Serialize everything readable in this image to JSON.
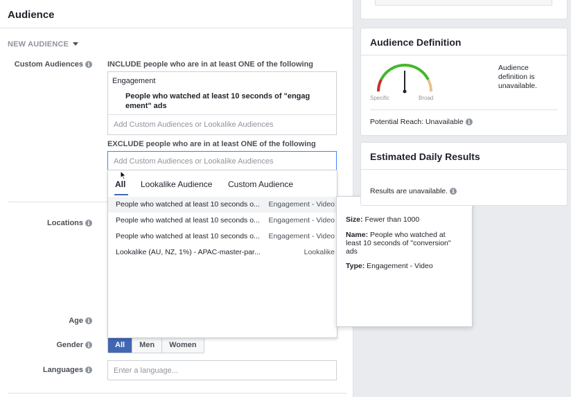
{
  "audience_panel": {
    "title": "Audience",
    "new_audience_label": "NEW AUDIENCE",
    "custom_audiences_label": "Custom Audiences",
    "include_heading": "INCLUDE people who are in at least ONE of the following",
    "include_category": "Engagement",
    "include_item_line1": "People who watched at least 10 seconds of \"engag",
    "include_item_line2": "ement\" ads",
    "include_add_placeholder": "Add Custom Audiences or Lookalike Audiences",
    "exclude_heading": "EXCLUDE people who are in at least ONE of the following",
    "exclude_placeholder": "Add Custom Audiences or Lookalike Audiences",
    "locations_label": "Locations",
    "age_label": "Age",
    "gender_label": "Gender",
    "gender_options": [
      "All",
      "Men",
      "Women"
    ],
    "gender_selected": "All",
    "languages_label": "Languages",
    "languages_placeholder": "Enter a language..."
  },
  "dropdown": {
    "tabs": [
      "All",
      "Lookalike Audience",
      "Custom Audience"
    ],
    "active_tab": "All",
    "rows": [
      {
        "name": "People who watched at least 10 seconds o...",
        "type": "Engagement - Video"
      },
      {
        "name": "People who watched at least 10 seconds o...",
        "type": "Engagement - Video"
      },
      {
        "name": "People who watched at least 10 seconds o...",
        "type": "Engagement - Video"
      },
      {
        "name": "Lookalike (AU, NZ, 1%) - APAC-master-par...",
        "type": "Lookalike"
      }
    ]
  },
  "tooltip": {
    "size_label": "Size:",
    "size_value": "Fewer than 1000",
    "name_label": "Name:",
    "name_value_line1": "People who watched at",
    "name_value_line2": "least 10 seconds of \"conversion\"",
    "name_value_line3": "ads",
    "type_label": "Type:",
    "type_value": "Engagement - Video"
  },
  "audience_definition": {
    "title": "Audience Definition",
    "gauge_specific": "Specific",
    "gauge_broad": "Broad",
    "message_line1": "Audience",
    "message_line2": "definition is",
    "message_line3": "unavailable.",
    "potential_reach": "Potential Reach: Unavailable"
  },
  "estimated_daily_results": {
    "title": "Estimated Daily Results",
    "message": "Results are unavailable."
  },
  "icons": {
    "info": "i"
  },
  "colors": {
    "accent": "#4267b2",
    "focus_border": "#4080ff",
    "gauge_red": "#c9302c",
    "gauge_green": "#42b72a",
    "gauge_tan": "#e8c28a"
  }
}
